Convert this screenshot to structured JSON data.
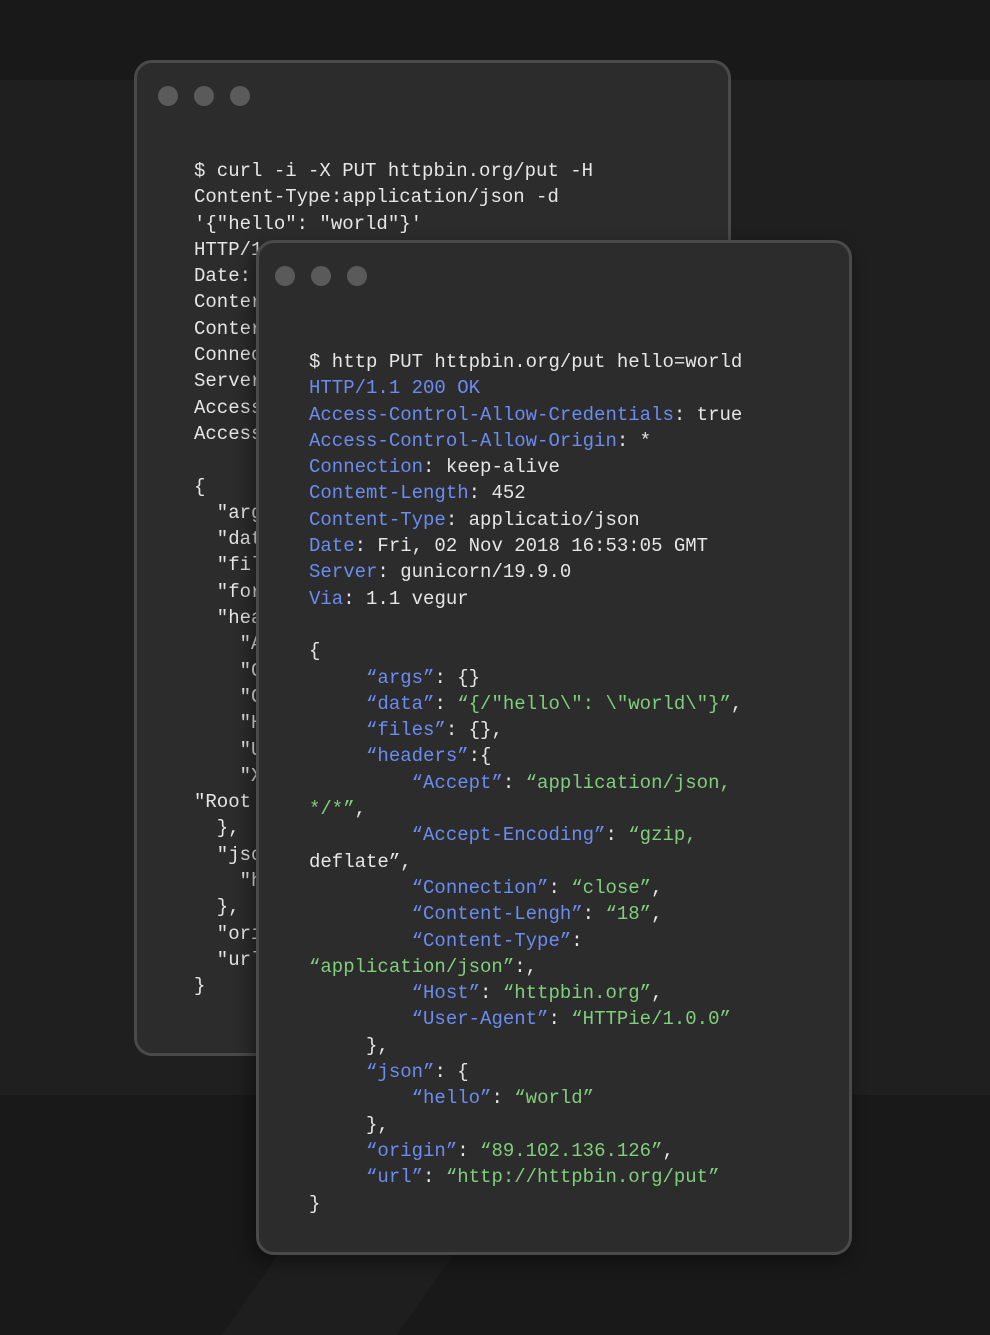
{
  "colors": {
    "background": "#191919",
    "window": "#2c2c2c",
    "window_border": "#4a4a4a",
    "text": "#e6e6e6",
    "key": "#6b8cf0",
    "string": "#7fcf7c",
    "traffic_light": "#5a5a5a"
  },
  "back_window": {
    "lines": [
      "$ curl -i -X PUT httpbin.org/put -H",
      "Content-Type:application/json -d",
      "'{\"hello\": \"world\"}'",
      "HTTP/1",
      "Date:",
      "Conter",
      "Conter",
      "Connec",
      "Server",
      "Access",
      "Access",
      "",
      "{",
      "  \"arg",
      "  \"dat",
      "  \"fil",
      "  \"for",
      "  \"hea",
      "    \"A",
      "    \"C",
      "    \"C",
      "    \"H",
      "    \"U",
      "    \"X",
      "\"Root",
      "  },",
      "  \"jsc",
      "    \"h",
      "  },",
      "  \"ori",
      "  \"url",
      "}"
    ]
  },
  "front_window": {
    "command": "$ http PUT httpbin.org/put hello=world",
    "status": {
      "protocol": "HTTP",
      "version": "/1.1",
      "code": "200",
      "reason": "OK"
    },
    "headers": [
      {
        "name": "Access-Control-Allow-Credentials",
        "value": "true"
      },
      {
        "name": "Access-Control-Allow-Origin",
        "value": "*"
      },
      {
        "name": "Connection",
        "value": "keep-alive"
      },
      {
        "name": "Contemt-Length",
        "value": "452"
      },
      {
        "name": "Content-Type",
        "value": "applicatio/json"
      },
      {
        "name": "Date",
        "value": "Fri, 02 Nov 2018 16:53:05 GMT"
      },
      {
        "name": "Server",
        "value": "gunicorn/19.9.0"
      },
      {
        "name": "Via",
        "value": "1.1 vegur"
      }
    ],
    "body": {
      "open": "{",
      "args_key": "“args”",
      "args_val": "{}",
      "data_key": "“data”",
      "data_val": "“{/\"hello\\\": \\\"world\\\"}”",
      "files_key": "“files”",
      "files_val": "{},",
      "headers_key": "“headers”",
      "headers_open": ":{",
      "accept_key": "“Accept”",
      "accept_val_1": "“application/json,",
      "accept_val_2": "*/*”",
      "accept_enc_key": "“Accept-Encoding”",
      "accept_enc_val_1": "“gzip,",
      "accept_enc_val_2": "deflate”",
      "connection_key": "“Connection”",
      "connection_val": "“close”",
      "content_length_key": "“Content-Lengh”",
      "content_length_val": "“18”",
      "content_type_key": "“Content-Type”",
      "content_type_val": "“application/json”",
      "host_key": "“Host”",
      "host_val": "“httpbin.org”",
      "user_agent_key": "“User-Agent”",
      "user_agent_val": "“HTTPie/1.0.0”",
      "headers_close": "},",
      "json_key": "“json”",
      "json_open": "{",
      "hello_key": "“hello”",
      "hello_val": "“world”",
      "json_close": "},",
      "origin_key": "“origin”",
      "origin_val": "“89.102.136.126”",
      "url_key": "“url”",
      "url_val": "“http://httpbin.org/put”",
      "close": "}"
    }
  }
}
